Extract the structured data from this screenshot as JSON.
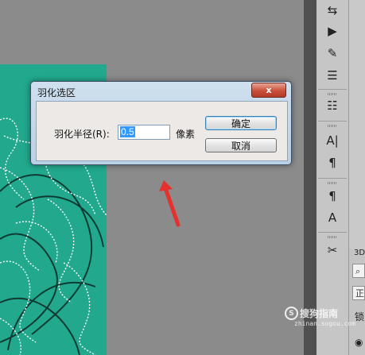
{
  "dialog": {
    "title": "羽化选区",
    "radius_label": "羽化半径(R):",
    "radius_value": "0.5",
    "unit": "像素",
    "ok_label": "确定",
    "cancel_label": "取消",
    "close_glyph": "x"
  },
  "tools": [
    {
      "name": "history-brush-icon",
      "glyph": "⇆"
    },
    {
      "name": "play-action-icon",
      "glyph": "▶"
    },
    {
      "name": "brush-presets-icon",
      "glyph": "✎"
    },
    {
      "name": "adjustments-icon",
      "glyph": "☰"
    },
    {
      "name": "layer-comps-icon",
      "glyph": "☷"
    },
    {
      "name": "character-icon",
      "glyph": "A|"
    },
    {
      "name": "paragraph-icon",
      "glyph": "¶"
    },
    {
      "name": "paragraph-styles-icon",
      "glyph": "¶"
    },
    {
      "name": "character-styles-icon",
      "glyph": "A"
    },
    {
      "name": "tool-presets-icon",
      "glyph": "✂"
    }
  ],
  "side_panel": {
    "tab_label": "3D",
    "row_label_1": "正",
    "row_label_2": "锁"
  },
  "watermark": {
    "brand": "搜狗指南",
    "url": "zhinan.sogou.com"
  },
  "colors": {
    "image_teal": "#22a98d",
    "arrow_red": "#e5312e",
    "close_red": "#c9503a"
  }
}
